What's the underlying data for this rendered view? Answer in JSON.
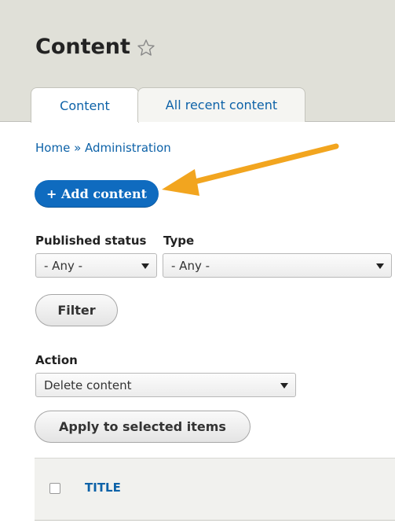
{
  "page": {
    "title": "Content",
    "star_icon": "star-outline-icon",
    "accent_color": "#0f6bbf",
    "arrow_color": "#f2a51f"
  },
  "tabs": [
    {
      "label": "Content",
      "active": true
    },
    {
      "label": "All recent content",
      "active": false
    }
  ],
  "breadcrumb": "Home » Administration",
  "add_button": {
    "label": "+ Add content"
  },
  "filters": {
    "published_status": {
      "label": "Published status",
      "value": "- Any -"
    },
    "type": {
      "label": "Type",
      "value": "- Any -"
    },
    "filter_button": "Filter"
  },
  "bulk": {
    "action_label": "Action",
    "action_value": "Delete content",
    "apply_button": "Apply to selected items"
  },
  "table": {
    "columns": [
      "TITLE"
    ]
  }
}
